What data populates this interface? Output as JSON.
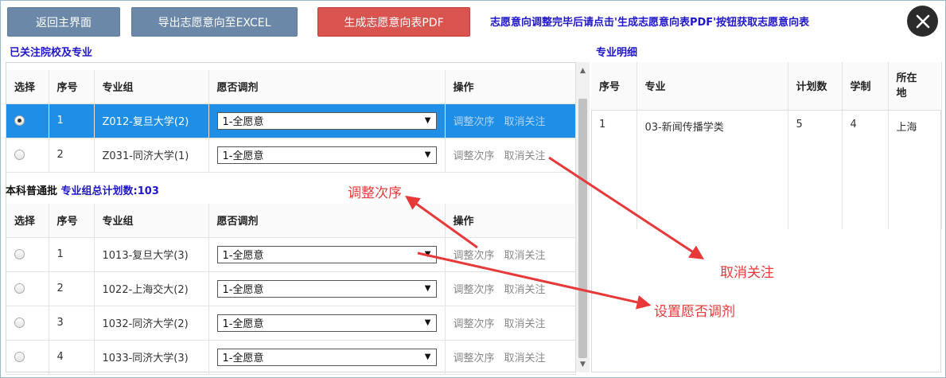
{
  "toolbar": {
    "back_label": "返回主界面",
    "export_label": "导出志愿意向至EXCEL",
    "pdf_label": "生成志愿意向表PDF",
    "notice": "志愿意向调整完毕后请点击'生成志愿意向表PDF'按钮获取志愿意向表"
  },
  "left": {
    "title": "已关注院校及专业",
    "headers": [
      "选择",
      "序号",
      "专业组",
      "愿否调剂",
      "操作"
    ],
    "rows": [
      {
        "no": "1",
        "group": "Z012-复旦大学(2)",
        "adjust": "1-全愿意",
        "selected": true
      },
      {
        "no": "2",
        "group": "Z031-同济大学(1)",
        "adjust": "1-全愿意",
        "selected": false
      }
    ],
    "op_reorder": "调整次序",
    "op_unfollow": "取消关注",
    "batch_name": "本科普通批",
    "batch_total": "专业组总计划数:103",
    "rows2": [
      {
        "no": "1",
        "group": "1013-复旦大学(3)",
        "adjust": "1-全愿意"
      },
      {
        "no": "2",
        "group": "1022-上海交大(2)",
        "adjust": "1-全愿意"
      },
      {
        "no": "3",
        "group": "1032-同济大学(2)",
        "adjust": "1-全愿意"
      },
      {
        "no": "4",
        "group": "1033-同济大学(3)",
        "adjust": "1-全愿意"
      }
    ]
  },
  "right": {
    "title": "专业明细",
    "headers": [
      "序号",
      "专业",
      "计划数",
      "学制",
      "所在地"
    ],
    "row": {
      "no": "1",
      "major": "03-新闻传播学类",
      "plan": "5",
      "years": "4",
      "location": "上海"
    }
  },
  "annotations": {
    "reorder": "调整次序",
    "unfollow": "取消关注",
    "adjust": "设置愿否调剂"
  },
  "colors": {
    "accent_blue": "#1f16c8",
    "selected_row": "#1e8ee6",
    "red_button": "#d9534f",
    "gray_button": "#6b88a8",
    "annotation_red": "#e8393a"
  }
}
